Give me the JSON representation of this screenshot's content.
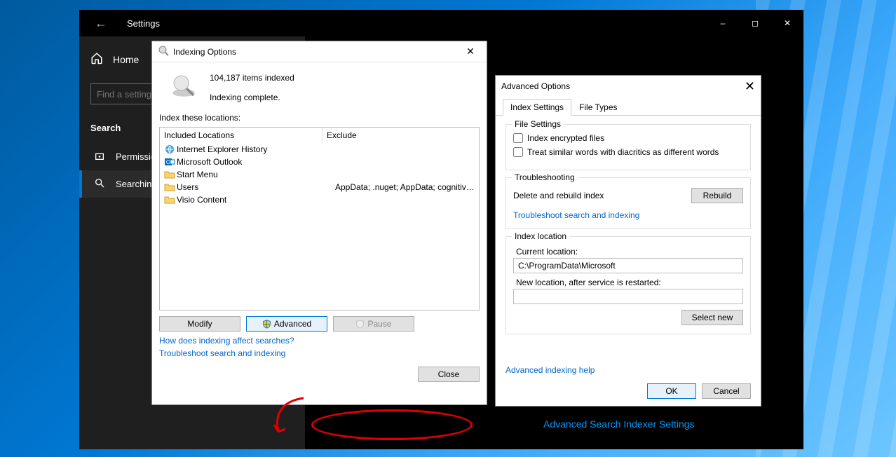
{
  "settings": {
    "title": "Settings",
    "home": "Home",
    "search_placeholder": "Find a setting",
    "section": "Search",
    "items": [
      {
        "icon": "lock",
        "label": "Permissions & History"
      },
      {
        "icon": "search",
        "label": "Searching Windows"
      }
    ],
    "advanced_indexer_link": "Advanced Search Indexer Settings"
  },
  "indexing": {
    "title": "Indexing Options",
    "items_indexed": "104,187 items indexed",
    "status": "Indexing complete.",
    "locations_label": "Index these locations:",
    "col_included": "Included Locations",
    "col_exclude": "Exclude",
    "rows": [
      {
        "icon": "ie",
        "name": "Internet Explorer History",
        "exclude": ""
      },
      {
        "icon": "outlook",
        "name": "Microsoft Outlook",
        "exclude": ""
      },
      {
        "icon": "folder",
        "name": "Start Menu",
        "exclude": ""
      },
      {
        "icon": "folder",
        "name": "Users",
        "exclude": "AppData; .nuget; AppData; cognitive-services..."
      },
      {
        "icon": "folder",
        "name": "Visio Content",
        "exclude": ""
      }
    ],
    "btn_modify": "Modify",
    "btn_advanced": "Advanced",
    "btn_pause": "Pause",
    "link_howaffect": "How does indexing affect searches?",
    "link_troubleshoot": "Troubleshoot search and indexing",
    "btn_close": "Close"
  },
  "advanced": {
    "title": "Advanced Options",
    "tab_index": "Index Settings",
    "tab_filetypes": "File Types",
    "group_file": "File Settings",
    "chk_encrypted": "Index encrypted files",
    "chk_diacritics": "Treat similar words with diacritics as different words",
    "group_trouble": "Troubleshooting",
    "label_rebuild": "Delete and rebuild index",
    "btn_rebuild": "Rebuild",
    "link_troubleshoot": "Troubleshoot search and indexing",
    "group_location": "Index location",
    "label_current": "Current location:",
    "current_value": "C:\\ProgramData\\Microsoft",
    "label_new": "New location, after service is restarted:",
    "btn_selectnew": "Select new",
    "link_help": "Advanced indexing help",
    "btn_ok": "OK",
    "btn_cancel": "Cancel"
  }
}
